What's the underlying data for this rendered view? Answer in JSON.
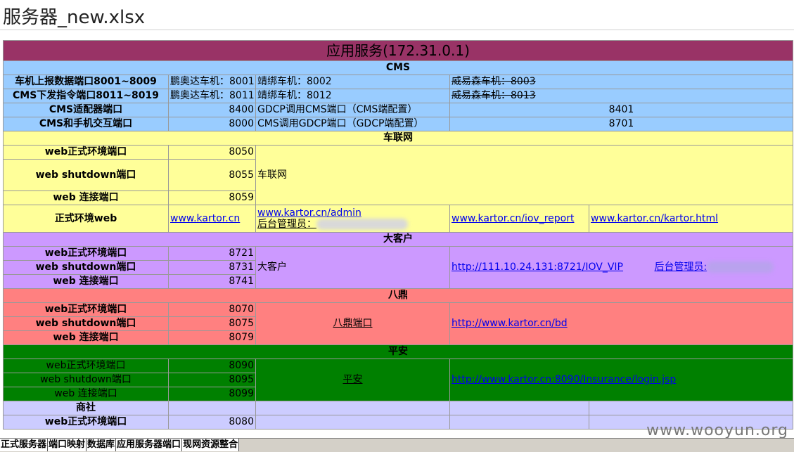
{
  "title": "服务器_new.xlsx",
  "sheet": {
    "header": "应用服务(172.31.0.1)",
    "cms": {
      "section": "CMS",
      "rows": [
        {
          "label": "车机上报数据端口8001~8009",
          "c2": "鹏奥达车机：8001",
          "c3": "靖绑车机：8002",
          "c4": "威易森车机：8003"
        },
        {
          "label": "CMS下发指令端口8011~8019",
          "c2": "鹏奥达车机：8011",
          "c3": "靖绑车机：8012",
          "c4": "威易森车机：8013"
        },
        {
          "label": "CMS适配器端口",
          "c2": "8400",
          "c3": "GDCP调用CMS端口（CMS端配置）",
          "c4": "8401"
        },
        {
          "label": "CMS和手机交互端口",
          "c2": "8000",
          "c3": "CMS调用GDCP端口（GDCP端配置）",
          "c4": "8701"
        }
      ]
    },
    "iov": {
      "section": "车联网",
      "rows": [
        {
          "label": "web正式环境端口",
          "port": "8050"
        },
        {
          "label": "web shutdown端口",
          "port": "8055"
        },
        {
          "label": "web 连接端口",
          "port": "8059"
        }
      ],
      "name": "车联网",
      "web_label": "正式环境web",
      "link1": "www.kartor.cn",
      "link2": "www.kartor.cn/admin",
      "admin_label": "后台管理员：",
      "link3": "www.kartor.cn/iov_report",
      "link4": "www.kartor.cn/kartor.html"
    },
    "vip": {
      "section": "大客户",
      "rows": [
        {
          "label": "web正式环境端口",
          "port": "8721"
        },
        {
          "label": "web shutdown端口",
          "port": "8731"
        },
        {
          "label": "web 连接端口",
          "port": "8741"
        }
      ],
      "name": "大客户",
      "link": "http://111.10.24.131:8721/IOV_VIP",
      "admin_label": "后台管理员:"
    },
    "bading": {
      "section": "八鼎",
      "rows": [
        {
          "label": "web正式环境端口",
          "port": "8070"
        },
        {
          "label": "web shutdown端口",
          "port": "8075"
        },
        {
          "label": "web 连接端口",
          "port": "8079"
        }
      ],
      "name": "八鼎端口",
      "link": "http://www.kartor.cn/bd"
    },
    "pingan": {
      "section": "平安",
      "rows": [
        {
          "label": "web正式环境端口",
          "port": "8090"
        },
        {
          "label": "web shutdown端口",
          "port": "8095"
        },
        {
          "label": "web 连接端口",
          "port": "8099"
        }
      ],
      "name": "平安",
      "link": "http://www.kartor.cn:8090/Insurance/login.jsp"
    },
    "shangshe": {
      "section": "商社",
      "rows": [
        {
          "label": "web正式环境端口",
          "port": "8080"
        }
      ]
    }
  },
  "tabs": [
    "正式服务器",
    "端口映射",
    "数据库",
    "应用服务器端口",
    "现网资源整合"
  ],
  "watermark": "www.wooyun.org",
  "colors": {
    "header": "#993366",
    "cms": "#99ccff",
    "iov": "#ffff99",
    "vip": "#cc99ff",
    "bading": "#ff8080",
    "pingan": "#008000",
    "shangshe": "#ccccff"
  }
}
